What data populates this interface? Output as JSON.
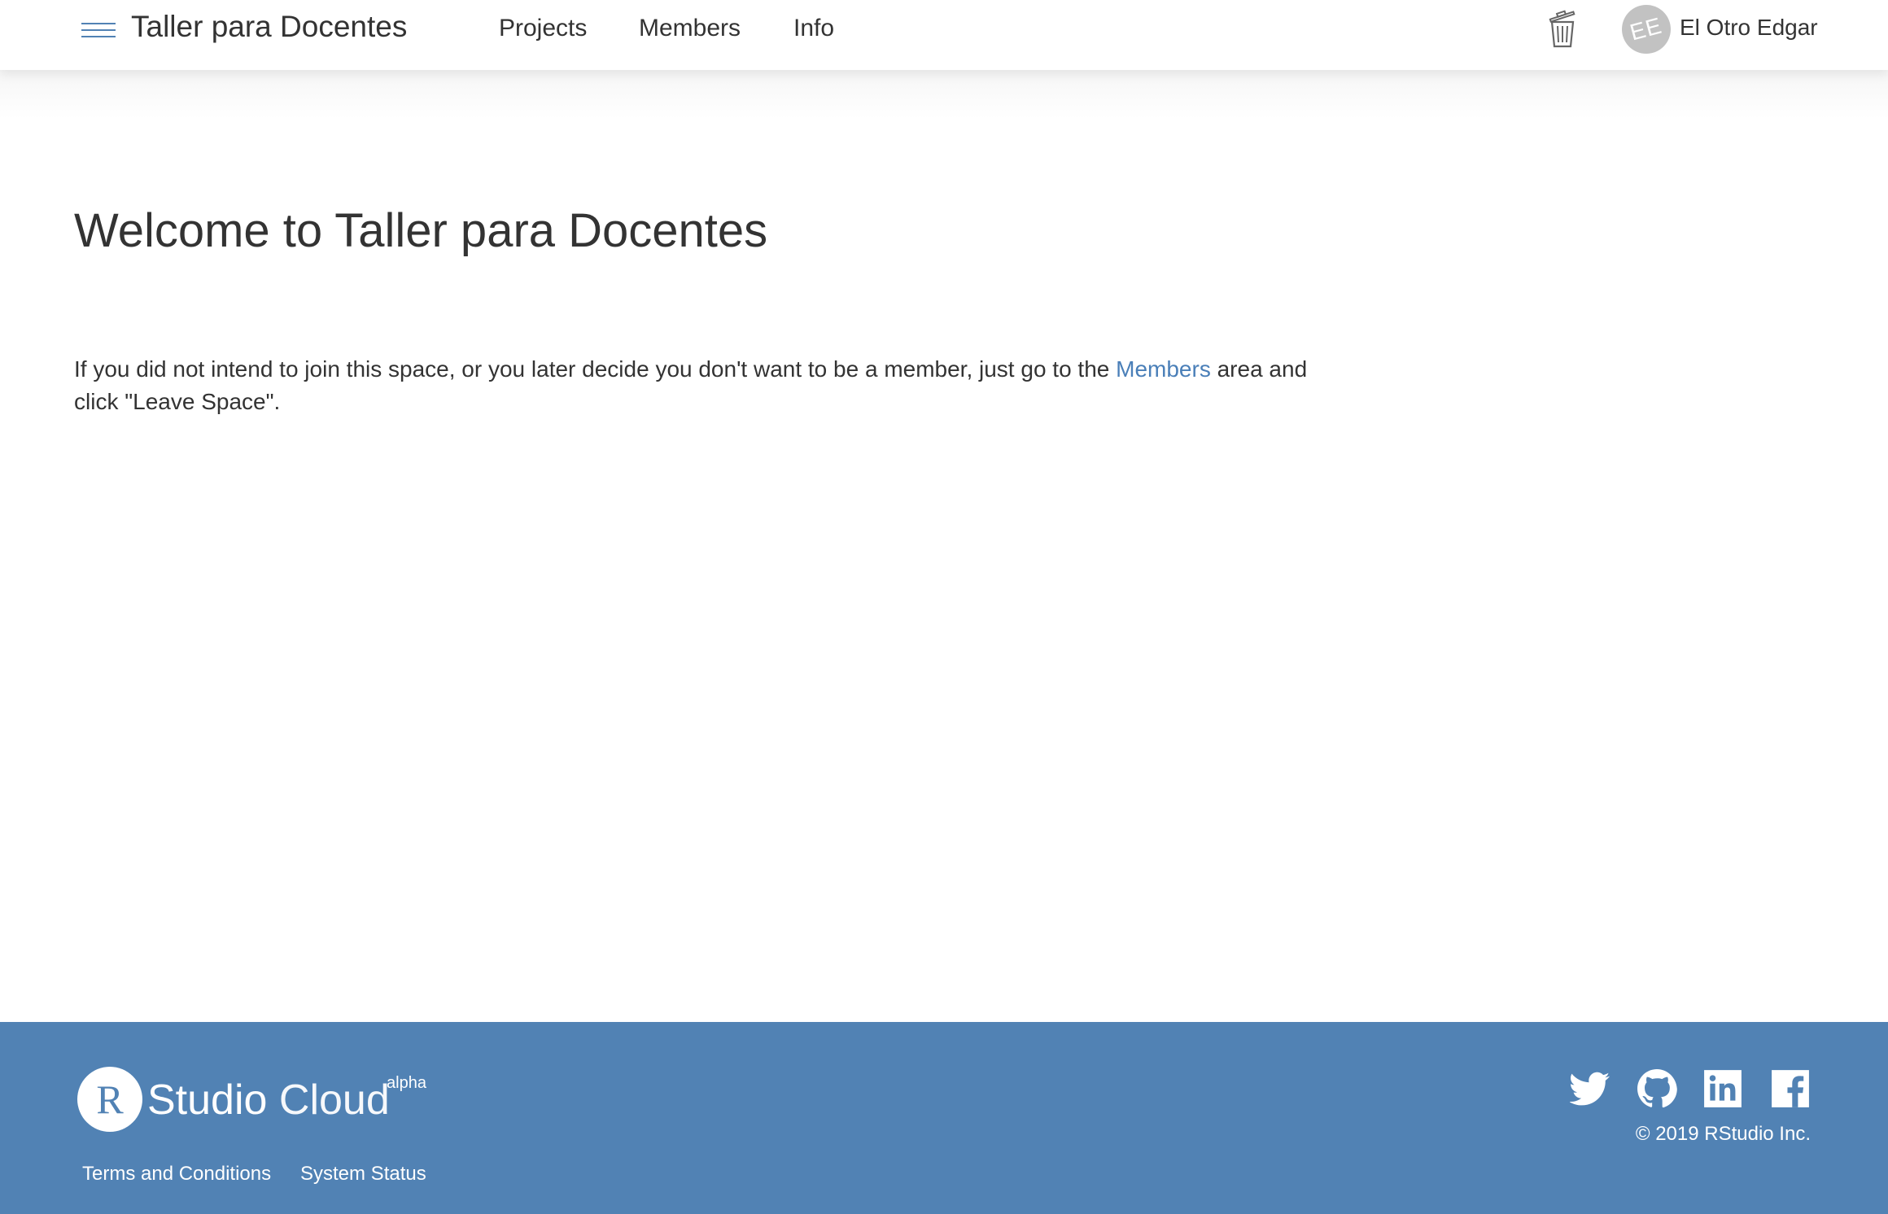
{
  "header": {
    "space_title": "Taller para Docentes",
    "nav": [
      {
        "label": "Projects"
      },
      {
        "label": "Members"
      },
      {
        "label": "Info"
      }
    ],
    "trash_icon": "trash-icon",
    "menu_icon": "hamburger-menu-icon",
    "user": {
      "initials": "EE",
      "name": "El Otro Edgar"
    }
  },
  "main": {
    "title": "Welcome to Taller para Docentes",
    "text_before_link": "If you did not intend to join this space, or you later decide you don't want to be a member, just go to the ",
    "link_label": "Members",
    "text_after_link": " area and click \"Leave Space\"."
  },
  "footer": {
    "logo_letter": "R",
    "logo_studio": "Studio",
    "logo_cloud": "Cloud",
    "logo_badge": "alpha",
    "links": [
      {
        "label": "Terms and Conditions"
      },
      {
        "label": "System Status"
      }
    ],
    "social_icons": [
      "twitter-icon",
      "github-icon",
      "linkedin-icon",
      "facebook-icon"
    ],
    "copyright": "© 2019 RStudio Inc."
  },
  "colors": {
    "accent_blue": "#5182b4",
    "link_blue": "#4a7fb8",
    "text": "#333333",
    "avatar_bg": "#c2c2c2"
  }
}
